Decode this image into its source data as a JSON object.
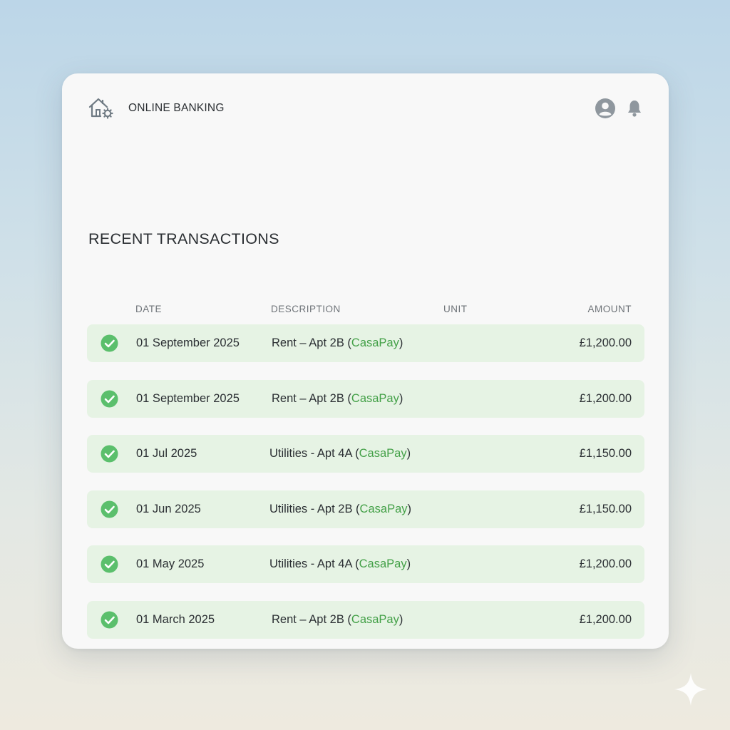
{
  "header": {
    "app_title": "ONLINE BANKING",
    "logo_icon": "house-gear-icon",
    "actions": [
      {
        "icon": "user-avatar-icon"
      },
      {
        "icon": "bell-icon"
      }
    ]
  },
  "section": {
    "title": "RECENT TRANSACTIONS"
  },
  "table": {
    "columns": {
      "date": "DATE",
      "description": "DESCRIPTION",
      "unit": "UNIT",
      "amount": "AMOUNT"
    },
    "rows": [
      {
        "status_icon": "check-circle-icon",
        "date": "01 September 2025",
        "description": "Rent – Apt 2B (",
        "provider": "CasaPay",
        "suffix": ")",
        "unit": "",
        "amount": "£1,200.00"
      },
      {
        "status_icon": "check-circle-icon",
        "date": "01 September 2025",
        "description": "Rent – Apt 2B (",
        "provider": "CasaPay",
        "suffix": ")",
        "unit": "",
        "amount": "£1,200.00"
      },
      {
        "status_icon": "check-circle-icon",
        "date": "01 Jul 2025",
        "description": "Utilities - Apt 4A (",
        "provider": "CasaPay",
        "suffix": ")",
        "unit": "",
        "amount": "£1,150.00"
      },
      {
        "status_icon": "check-circle-icon",
        "date": "01 Jun 2025",
        "description": "Utilities - Apt 2B (",
        "provider": "CasaPay",
        "suffix": ")",
        "unit": "",
        "amount": "£1,150.00"
      },
      {
        "status_icon": "check-circle-icon",
        "date": "01 May 2025",
        "description": "Utilities - Apt 4A (",
        "provider": "CasaPay",
        "suffix": ")",
        "unit": "",
        "amount": "£1,200.00"
      },
      {
        "status_icon": "check-circle-icon",
        "date": "01 March 2025",
        "description": "Rent – Apt 2B (",
        "provider": "CasaPay",
        "suffix": ")",
        "unit": "",
        "amount": "£1,200.00"
      }
    ]
  },
  "colors": {
    "row_background": "#e6f3e4",
    "check_green": "#5bbf6c",
    "provider_green": "#43a047",
    "icon_gray": "#8f979e"
  }
}
